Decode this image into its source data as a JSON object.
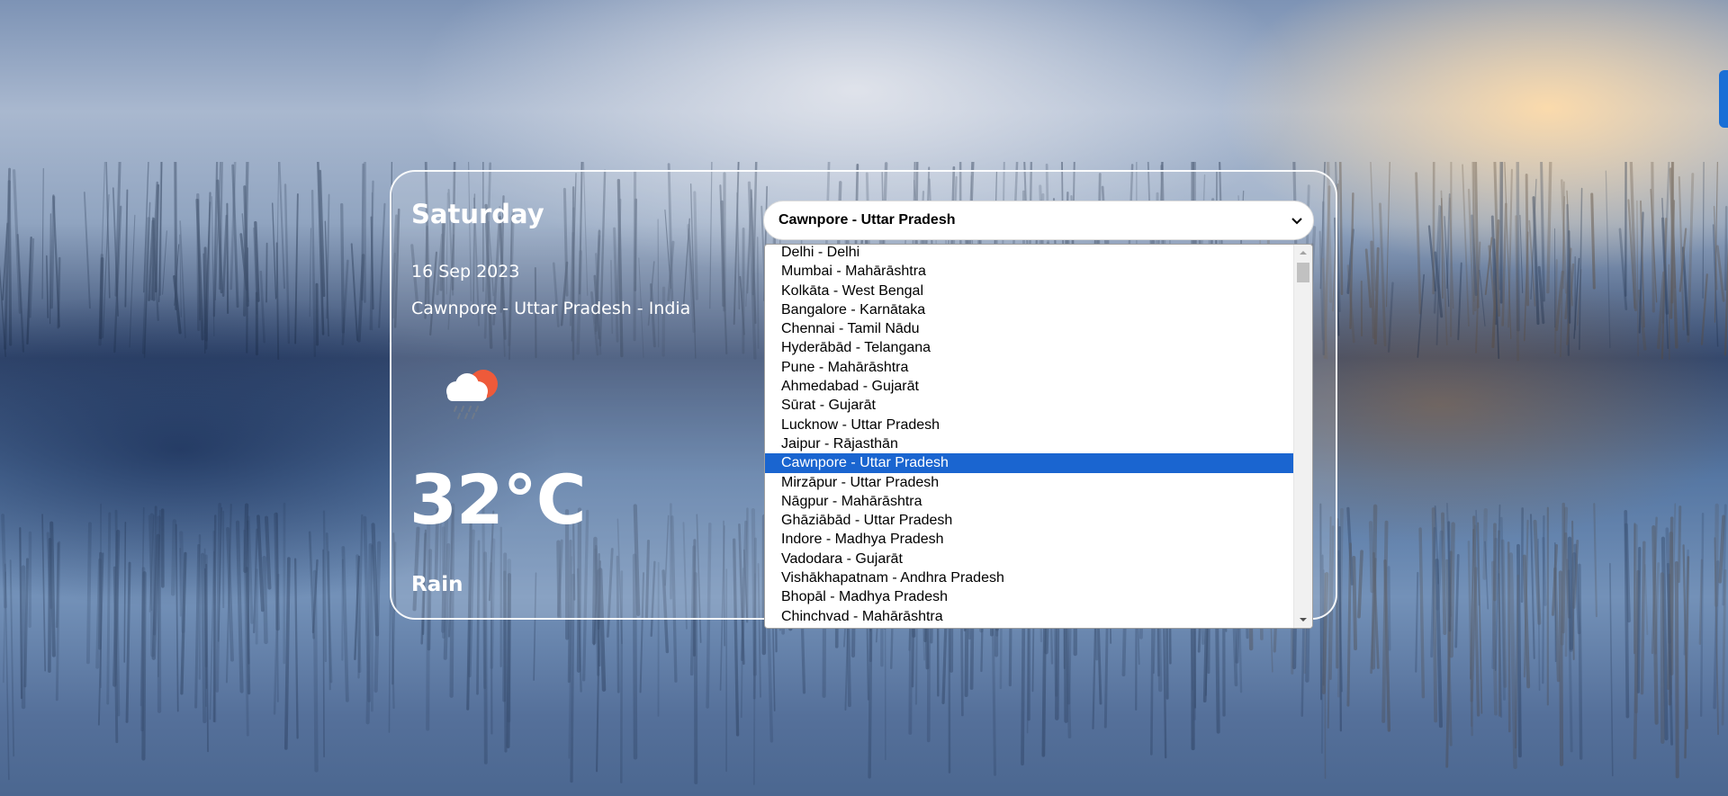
{
  "weather": {
    "day": "Saturday",
    "date": "16 Sep 2023",
    "location": "Cawnpore - Uttar Pradesh - India",
    "temperature": "32°C",
    "condition": "Rain",
    "icon": "cloud-sun-rain-icon"
  },
  "city_select": {
    "selected": "Cawnpore - Uttar Pradesh",
    "options": [
      "Delhi - Delhi",
      "Mumbai - Mahārāshtra",
      "Kolkāta - West Bengal",
      "Bangalore - Karnātaka",
      "Chennai - Tamil Nādu",
      "Hyderābād - Telangana",
      "Pune - Mahārāshtra",
      "Ahmedabad - Gujarāt",
      "Sūrat - Gujarāt",
      "Lucknow - Uttar Pradesh",
      "Jaipur - Rājasthān",
      "Cawnpore - Uttar Pradesh",
      "Mirzāpur - Uttar Pradesh",
      "Nāgpur - Mahārāshtra",
      "Ghāziābād - Uttar Pradesh",
      "Indore - Madhya Pradesh",
      "Vadodara - Gujarāt",
      "Vishākhapatnam - Andhra Pradesh",
      "Bhopāl - Madhya Pradesh",
      "Chinchvad - Mahārāshtra"
    ],
    "selected_index": 11
  },
  "colors": {
    "highlight": "#1a65d0",
    "card_border": "#ffffff",
    "text": "#ffffff"
  }
}
